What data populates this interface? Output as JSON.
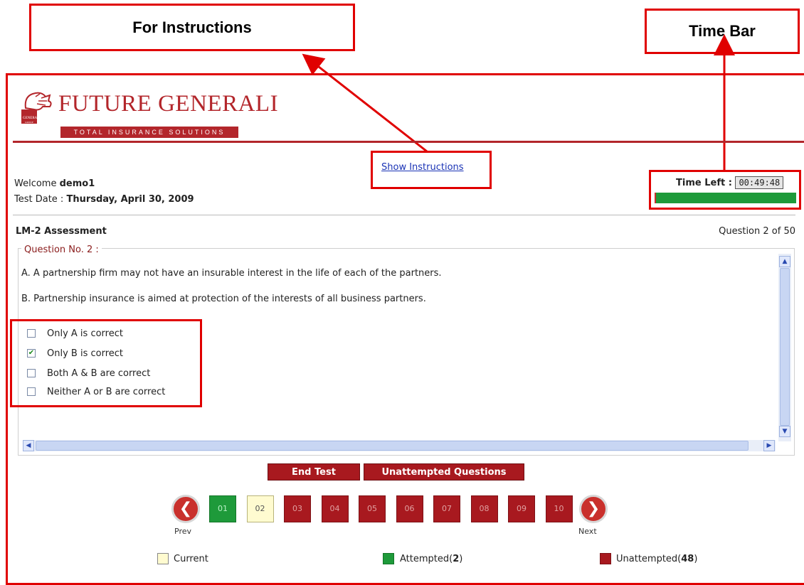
{
  "annotations": {
    "instructions_callout": "For Instructions",
    "timebar_callout": "Time Bar"
  },
  "brand": {
    "name": "FUTURE GENERALI",
    "tagline": "TOTAL INSURANCE SOLUTIONS",
    "seal_text": "GENERALI GROUP"
  },
  "header": {
    "show_instructions": "Show Instructions",
    "welcome_prefix": "Welcome",
    "username": "demo1",
    "test_date_label": "Test Date :",
    "test_date": "Thursday, April 30, 2009",
    "time_left_label": "Time Left :",
    "time_left_value": "00:49:48",
    "time_remaining_fraction": 0.99
  },
  "test": {
    "title": "LM-2 Assessment",
    "progress": "Question 2 of 50",
    "question_label": "Question No. 2 :",
    "statements": [
      "A. A partnership firm may not have an insurable interest in the life of each of the partners.",
      "B. Partnership insurance is aimed at protection of the interests of all business partners."
    ],
    "options": [
      {
        "label": "Only A is correct",
        "checked": false
      },
      {
        "label": "Only B is correct",
        "checked": true
      },
      {
        "label": "Both A & B are correct",
        "checked": false
      },
      {
        "label": "Neither A or B are correct",
        "checked": false
      }
    ]
  },
  "actions": {
    "end_test": "End Test",
    "unattempted": "Unattempted Questions"
  },
  "pager": {
    "prev": "Prev",
    "next": "Next",
    "pages": [
      {
        "label": "01",
        "state": "attempted"
      },
      {
        "label": "02",
        "state": "current"
      },
      {
        "label": "03",
        "state": "unattempted"
      },
      {
        "label": "04",
        "state": "unattempted"
      },
      {
        "label": "05",
        "state": "unattempted"
      },
      {
        "label": "06",
        "state": "unattempted"
      },
      {
        "label": "07",
        "state": "unattempted"
      },
      {
        "label": "08",
        "state": "unattempted"
      },
      {
        "label": "09",
        "state": "unattempted"
      },
      {
        "label": "10",
        "state": "unattempted"
      }
    ]
  },
  "legend": {
    "current": "Current",
    "attempted_label": "Attempted(",
    "attempted_count": "2",
    "unattempted_label": "Unattempted(",
    "unattempted_count": "48",
    "close_paren": ")"
  },
  "colors": {
    "annotation_red": "#e00000",
    "brand_red": "#b3262b",
    "attempted_green": "#1e9a3a",
    "unattempted_red": "#a8191f",
    "current_yellow": "#fffbd0"
  }
}
